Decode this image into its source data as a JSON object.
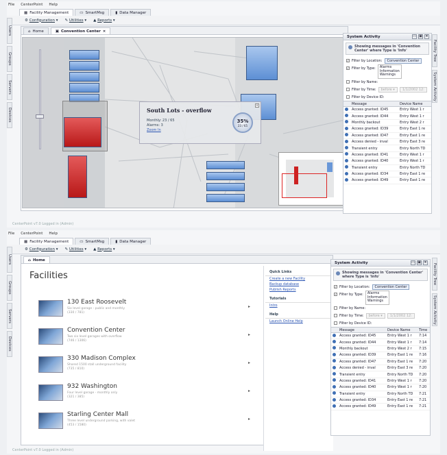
{
  "menu": [
    "File",
    "CenterPoint",
    "Help"
  ],
  "app_tabs": [
    "Facility Management",
    "SmartMsg",
    "Data Manager"
  ],
  "toolbar": [
    "Configuration",
    "Utilities",
    "Reports"
  ],
  "left_tabs": [
    "Users",
    "Groups",
    "Servers",
    "Devices"
  ],
  "right_tabs": [
    "Facility Tree",
    "System Activity"
  ],
  "status_text": "CenterPoint v7.0 Logged in (Admin)",
  "screen1": {
    "tab_home": "Home",
    "tab_convention": "Convention Center",
    "popup": {
      "title": "South Lots - overflow",
      "monthly": "Monthly: 23 / 65",
      "alarms": "Alarms: 3",
      "zoom": "Zoom In",
      "percent": "35%",
      "fraction": "23 / 65"
    }
  },
  "screen2": {
    "tab_home": "Home",
    "heading": "Facilities",
    "facilities": [
      {
        "name": "130 East Roosevelt",
        "desc": "Six level garage - public and monthly",
        "count": "(330 / 781)"
      },
      {
        "name": "Convention Center",
        "desc": "Two six level garages with overflow",
        "count": "(746 / 1306)"
      },
      {
        "name": "330 Madison Complex",
        "desc": "Shared 1500 stall underground facility",
        "count": "(735 / 810)"
      },
      {
        "name": "932 Washington",
        "desc": "Four level garage - monthly only",
        "count": "(321 / 385)"
      },
      {
        "name": "Starling Center Mall",
        "desc": "Three level underground parking, with valet",
        "count": "(453 / 1580)"
      }
    ],
    "quick_links": {
      "title": "Quick Links",
      "links": [
        "Create a new Facility",
        "Backup database",
        "Publish Reports"
      ],
      "tutorials_title": "Tutorials",
      "tutorials": [
        "Intro"
      ],
      "help_title": "Help",
      "help": [
        "Launch Online Help"
      ]
    }
  },
  "activity": {
    "title": "System Activity",
    "info": "Showing messages in 'Convention Center' where Type is 'Info'",
    "filter_location": "Filter by Location:",
    "location_btn": "Convention Center",
    "filter_type": "Filter by Type:",
    "types": [
      "Alarms",
      "Information",
      "Warnings"
    ],
    "filter_name": "Filter by Name:",
    "filter_time": "Filter by Time:",
    "time_before": "before",
    "time_date": "1/1/2002 12:",
    "filter_device": "Filter by Device ID:",
    "columns": [
      "Message",
      "Device Name",
      "Time"
    ],
    "rows": [
      [
        "Access granted: ID45",
        "Entry West 1 r",
        "7:14"
      ],
      [
        "Access granted: ID44",
        "Entry West 1 r",
        "7:14"
      ],
      [
        "Monthly backout",
        "Entry West 2 r",
        "7:15"
      ],
      [
        "Access granted: ID39",
        "Entry East 1 re",
        "7:16"
      ],
      [
        "Access granted: ID47",
        "Entry East 1 re",
        "7:20"
      ],
      [
        "Access denied - inval",
        "Entry East 3 re",
        "7:20"
      ],
      [
        "Transient entry",
        "Entry North TD",
        "7:20"
      ],
      [
        "Access granted: ID41",
        "Entry West 1 r",
        "7:20"
      ],
      [
        "Access granted: ID40",
        "Entry West 1 r",
        "7:20"
      ],
      [
        "Transient entry",
        "Entry North TD",
        "7:21"
      ],
      [
        "Access granted: ID34",
        "Entry East 1 re",
        "7:21"
      ],
      [
        "Access granted: ID49",
        "Entry East 1 re",
        "7:21"
      ]
    ]
  }
}
